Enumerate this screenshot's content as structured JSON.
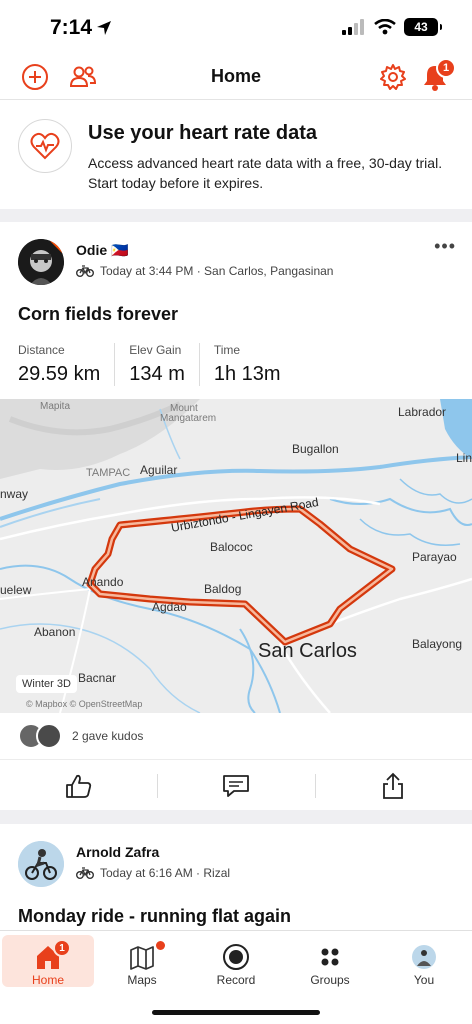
{
  "status_bar": {
    "time": "7:14",
    "battery": "43"
  },
  "header": {
    "title": "Home",
    "notification_count": "1"
  },
  "promo": {
    "title": "Use your heart rate data",
    "text": "Access advanced heart rate data with a free, 30-day trial. Start today before it expires."
  },
  "activity1": {
    "athlete": "Odie 🇵🇭",
    "meta": "Today at 3:44 PM · San Carlos, Pangasinan",
    "title": "Corn fields forever",
    "stats": [
      {
        "label": "Distance",
        "value": "29.59 km"
      },
      {
        "label": "Elev Gain",
        "value": "134 m"
      },
      {
        "label": "Time",
        "value": "1h 13m"
      }
    ],
    "map": {
      "labels": {
        "mapita": "Mapita",
        "mount": "Mount",
        "mangatarem": "Mangatarem",
        "labrador": "Labrador",
        "bugallon": "Bugallon",
        "lin": "Lin",
        "tampac": "TAMPAC",
        "aguilar": "Aguilar",
        "nway": "nway",
        "road": "Urbiztondo - Lingayen Road",
        "balococ": "Balococ",
        "parayao": "Parayao",
        "uelew": "uelew",
        "anando": "Anando",
        "baldog": "Baldog",
        "agdao": "Agdao",
        "abanon": "Abanon",
        "san_carlos": "San Carlos",
        "balayong": "Balayong",
        "bacnar": "Bacnar"
      },
      "style_chip": "Winter 3D",
      "attribution": "© Mapbox © OpenStreetMap"
    },
    "kudos_text": "2 gave kudos"
  },
  "activity2": {
    "athlete": "Arnold Zafra",
    "meta": "Today at 6:16 AM · Rizal",
    "title": "Monday ride - running flat again"
  },
  "nav": {
    "items": [
      {
        "label": "Home",
        "badge": "1"
      },
      {
        "label": "Maps"
      },
      {
        "label": "Record"
      },
      {
        "label": "Groups"
      },
      {
        "label": "You"
      }
    ]
  },
  "colors": {
    "accent": "#fc4c02",
    "route": "#e8401c",
    "water": "#8ec6ec"
  }
}
